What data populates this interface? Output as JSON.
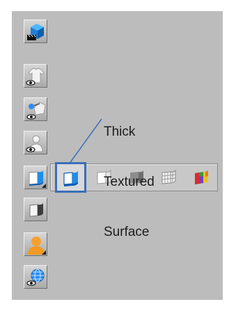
{
  "callout": {
    "lines": [
      "Thick",
      "Textured",
      "Surface"
    ]
  },
  "toolbar": {
    "buttons": [
      {
        "icon": "blue-cube-clapper-icon"
      },
      {
        "icon": "tshirt-eye-icon"
      },
      {
        "icon": "pick-cloth-eye-icon"
      },
      {
        "icon": "person-eye-icon"
      },
      {
        "icon": "thick-surface-icon"
      },
      {
        "icon": "gray-surface-icon"
      },
      {
        "icon": "orange-avatar-icon"
      },
      {
        "icon": "globe-eye-icon"
      }
    ],
    "flyout_items": [
      {
        "icon": "thick-textured-surface-icon",
        "selected": true
      },
      {
        "icon": "white-sheet-icon"
      },
      {
        "icon": "gray-sheet-icon"
      },
      {
        "icon": "mesh-grid-icon"
      },
      {
        "icon": "rainbow-texture-icon"
      }
    ]
  },
  "colors": {
    "panel": "#bcbcbc",
    "highlight": "#3a6fb8",
    "accent_blue": "#1f8de8"
  }
}
